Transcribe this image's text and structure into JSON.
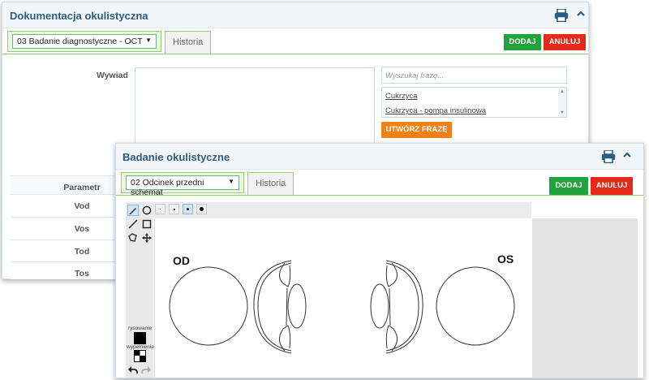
{
  "panel1": {
    "title": "Dokumentacja okulistyczna",
    "select_value": "03 Badanie diagnostyczne - OCT",
    "tab_history": "Historia",
    "add_button": "DODAJ",
    "cancel_button": "ANULUJ",
    "wywiad_label": "Wywiad",
    "search_placeholder": "Wyszukaj frazę...",
    "suggestions": [
      "Cukrzyca",
      "Cukrzyca - pompa insulinowa"
    ],
    "create_phrase_button": "UTWÓRZ FRAZĘ",
    "table_header": "Parametr",
    "table_rows": [
      "Vod",
      "Vos",
      "Tod",
      "Tos"
    ]
  },
  "panel2": {
    "title": "Badanie okulistyczne",
    "select_value": "02 Odcinek przedni schemat",
    "tab_history": "Historia",
    "add_button": "DODAJ",
    "cancel_button": "ANULUJ",
    "draw_label": "rysowanie",
    "fill_label": "wypełnienie",
    "od_label": "OD",
    "os_label": "OS"
  },
  "icons": [
    "print-icon",
    "collapse-up-icon",
    "pencil-icon",
    "circle-icon",
    "line-icon",
    "square-icon",
    "polygon-icon",
    "move-icon",
    "undo-icon",
    "redo-icon"
  ],
  "colors": {
    "title_blue": "#2a5d84",
    "green": "#22a23c",
    "red": "#e52a1a",
    "orange": "#f08018",
    "tab_border": "#8fd16b"
  }
}
